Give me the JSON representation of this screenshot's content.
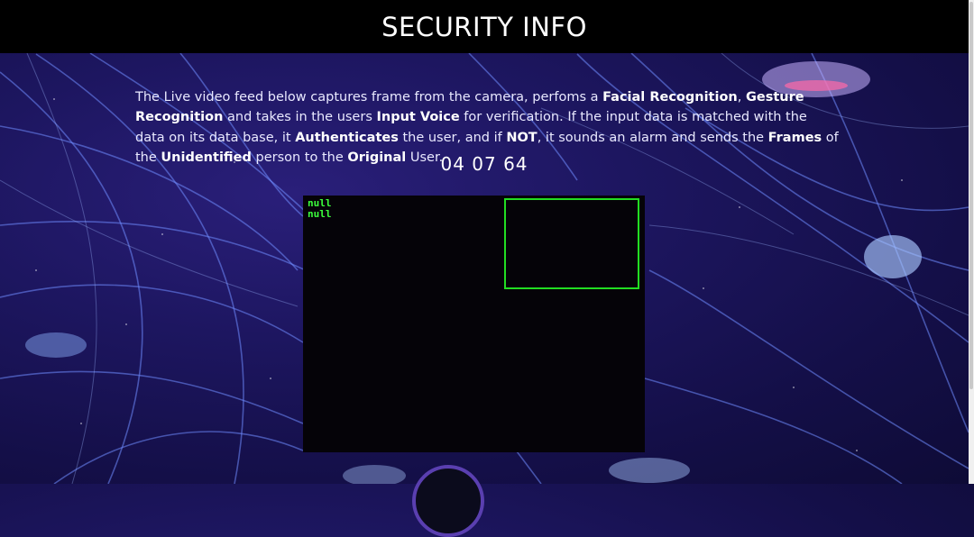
{
  "header": {
    "title": "SECURITY INFO"
  },
  "description": {
    "parts": [
      {
        "text": "The Live video feed below captures frame from the camera, perfoms a ",
        "bold": false
      },
      {
        "text": "Facial Recognition",
        "bold": true
      },
      {
        "text": ", ",
        "bold": false
      },
      {
        "text": "Gesture Recognition",
        "bold": true
      },
      {
        "text": " and takes in the users ",
        "bold": false
      },
      {
        "text": "Input Voice",
        "bold": true
      },
      {
        "text": " for verification. If the input data is matched with the data on its data base, it ",
        "bold": false
      },
      {
        "text": "Authenticates",
        "bold": true
      },
      {
        "text": " the user, and if ",
        "bold": false
      },
      {
        "text": "NOT",
        "bold": true
      },
      {
        "text": ", it sounds an alarm and sends the ",
        "bold": false
      },
      {
        "text": "Frames",
        "bold": true
      },
      {
        "text": " of the ",
        "bold": false
      },
      {
        "text": "Unidentified",
        "bold": true
      },
      {
        "text": " person to the ",
        "bold": false
      },
      {
        "text": "Original",
        "bold": true
      },
      {
        "text": " User.",
        "bold": false
      }
    ]
  },
  "timer": {
    "value": "04 07 64"
  },
  "video": {
    "overlay_line1": "null",
    "overlay_line2": "null",
    "face_box_color": "#22dd22",
    "overlay_text_color": "#3cff3c"
  },
  "colors": {
    "header_bg": "#000000",
    "background": "#1d1660"
  }
}
